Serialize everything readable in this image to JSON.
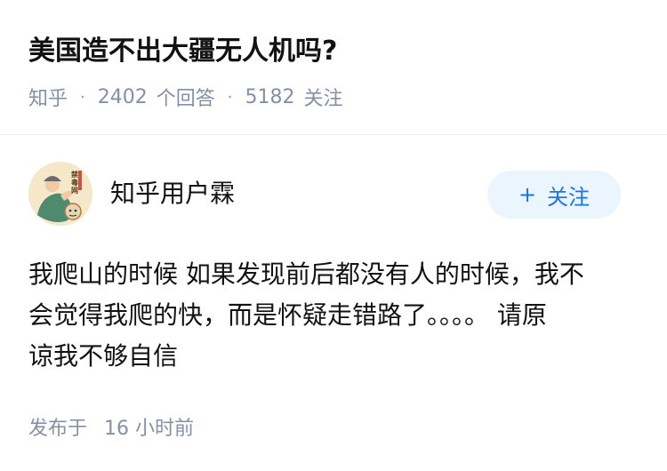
{
  "question": {
    "title": "美国造不出大疆无人机吗?",
    "source": "知乎",
    "answer_count": "2402",
    "answer_label": "个回答",
    "follow_count": "5182",
    "follow_label": "关注",
    "separator": "·"
  },
  "author": {
    "name": "知乎用户霖",
    "avatar_text": "禁毒网",
    "follow_button_icon": "plus-icon",
    "follow_button_plus": "+",
    "follow_button_label": "关注"
  },
  "answer": {
    "lines": [
      "我爬山的时候 如果发现前后都没有人的时候，我不",
      "会觉得我爬的快，而是怀疑走错路了。。。。 请原",
      "谅我不够自信"
    ],
    "published_label": "发布于",
    "published_time": "16 小时前"
  },
  "colors": {
    "primary_text": "#121212",
    "meta_text": "#8590a6",
    "follow_button_bg": "#ebf5fd",
    "follow_button_text": "#1772f6",
    "divider": "#ebebeb"
  }
}
